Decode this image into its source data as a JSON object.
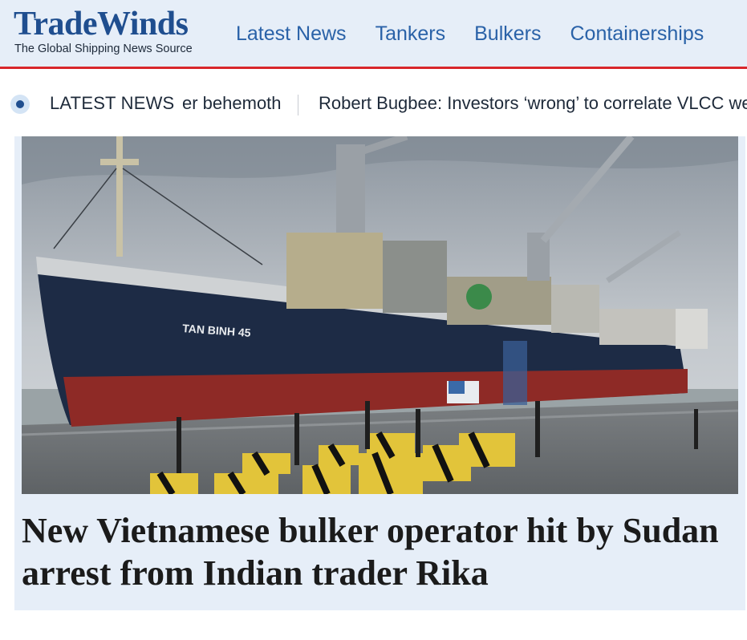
{
  "brand": {
    "name": "TradeWinds",
    "tagline": "The Global Shipping News Source"
  },
  "nav": {
    "items": [
      {
        "label": "Latest News"
      },
      {
        "label": "Tankers"
      },
      {
        "label": "Bulkers"
      },
      {
        "label": "Containerships"
      }
    ]
  },
  "ticker": {
    "label": "LATEST NEWS",
    "items": [
      {
        "text": "er behemoth"
      },
      {
        "text": "Robert Bugbee: Investors ‘wrong’ to correlate VLCC wea"
      }
    ]
  },
  "article": {
    "image_alt": "Bulk carrier TAN BINH 45 moored at a quayside with cranes",
    "ship_name": "TAN BINH 45",
    "headline": "New Vietnamese bulker operator hit by Sudan arrest from Indian trader Rika"
  },
  "colors": {
    "brand_blue": "#1f4e8f",
    "nav_blue": "#2a62a8",
    "header_bg": "#e6eef8",
    "accent_red": "#d8262b"
  }
}
